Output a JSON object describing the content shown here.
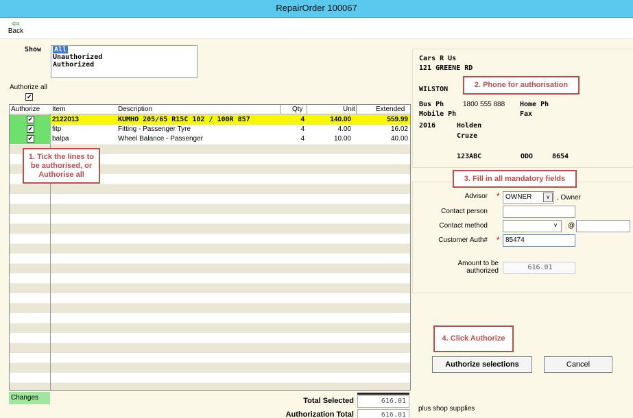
{
  "window": {
    "title": "RepairOrder 100067"
  },
  "toolbar": {
    "back_label": "Back",
    "back_icon": "green-left-arrow-icon"
  },
  "show": {
    "label": "Show",
    "options": [
      "All",
      "Unauthorized",
      "Authorized"
    ],
    "selected": "All"
  },
  "authorize_all": {
    "label": "Authorize all",
    "checked": true
  },
  "grid": {
    "headers": [
      "Authorize",
      "Item",
      "Description",
      "Qty",
      "Unit",
      "Extended"
    ],
    "rows": [
      {
        "authorized": true,
        "item": "2122013",
        "description": "KUMHO 205/65 R15C 102 / 100R 857",
        "qty": "4",
        "unit": "140.00",
        "extended": "559.99",
        "highlighted": true
      },
      {
        "authorized": true,
        "item": "fitp",
        "description": "Fitting - Passenger Tyre",
        "qty": "4",
        "unit": "4.00",
        "extended": "16.02",
        "highlighted": false
      },
      {
        "authorized": true,
        "item": "balpa",
        "description": "Wheel Balance - Passenger",
        "qty": "4",
        "unit": "10.00",
        "extended": "40.00",
        "highlighted": false
      }
    ]
  },
  "callouts": {
    "c1": "1. Tick the lines to be authorised, or Authorise all",
    "c2": "2. Phone for authorisation",
    "c3": "3. Fill in all mandatory fields",
    "c4": "4. Click Authorize"
  },
  "changes_label": "Changes",
  "totals": {
    "selected_label": "Total Selected",
    "selected_value": "616.01",
    "auth_label": "Authorization Total",
    "auth_value": "616.01",
    "shop_note": "plus shop supplies"
  },
  "customer": {
    "name": "Cars R Us",
    "address": "121 GREENE RD",
    "city": "WILSTON",
    "bus_ph_label": "Bus Ph",
    "bus_ph": "1800 555 888",
    "home_ph_label": "Home Ph",
    "mobile_label": "Mobile Ph",
    "fax_label": "Fax",
    "year": "2016",
    "make": "Holden",
    "model": "Cruze",
    "rego": "123ABC",
    "odo_label": "ODO",
    "odo": "8654"
  },
  "form": {
    "advisor_label": "Advisor",
    "advisor_value": "OWNER",
    "advisor_suffix": ", Owner",
    "contact_person_label": "Contact person",
    "contact_person_value": "",
    "contact_method_label": "Contact method",
    "contact_method_value": "",
    "at_sign": "@",
    "customer_auth_label": "Customer Auth#",
    "customer_auth_value": "85474",
    "amount_label": "Amount to be authorized",
    "amount_value": "616.01",
    "required_marker": "*"
  },
  "buttons": {
    "authorize": "Authorize selections",
    "cancel": "Cancel"
  }
}
